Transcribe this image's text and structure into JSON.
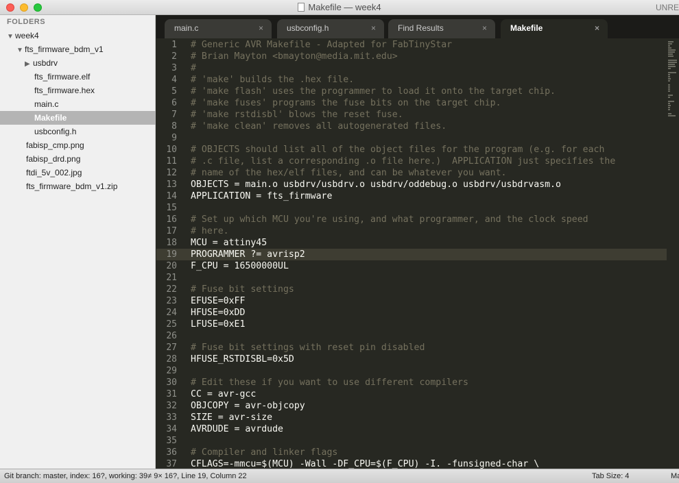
{
  "window": {
    "title": "Makefile — week4",
    "unregistered": "UNRE"
  },
  "sidebar": {
    "header": "FOLDERS",
    "items": [
      {
        "label": "week4",
        "arrow": "▼"
      },
      {
        "label": "fts_firmware_bdm_v1",
        "arrow": "▼"
      },
      {
        "label": "usbdrv",
        "arrow": "▶"
      },
      {
        "label": "fts_firmware.elf"
      },
      {
        "label": "fts_firmware.hex"
      },
      {
        "label": "main.c"
      },
      {
        "label": "Makefile"
      },
      {
        "label": "usbconfig.h"
      },
      {
        "label": "fabisp_cmp.png"
      },
      {
        "label": "fabisp_drd.png"
      },
      {
        "label": "ftdi_5v_002.jpg"
      },
      {
        "label": "fts_firmware_bdm_v1.zip"
      }
    ]
  },
  "tabs": [
    {
      "label": "main.c",
      "close": "×"
    },
    {
      "label": "usbconfig.h",
      "close": "×"
    },
    {
      "label": "Find Results",
      "close": "×"
    },
    {
      "label": "Makefile",
      "close": "×"
    }
  ],
  "editor": {
    "lines": [
      {
        "n": "1",
        "text": "# Generic AVR Makefile - Adapted for FabTinyStar"
      },
      {
        "n": "2",
        "text": "# Brian Mayton <bmayton@media.mit.edu>"
      },
      {
        "n": "3",
        "text": "#"
      },
      {
        "n": "4",
        "text": "# 'make' builds the .hex file."
      },
      {
        "n": "5",
        "text": "# 'make flash' uses the programmer to load it onto the target chip."
      },
      {
        "n": "6",
        "text": "# 'make fuses' programs the fuse bits on the target chip."
      },
      {
        "n": "7",
        "text": "# 'make rstdisbl' blows the reset fuse."
      },
      {
        "n": "8",
        "text": "# 'make clean' removes all autogenerated files."
      },
      {
        "n": "9",
        "text": ""
      },
      {
        "n": "10",
        "text": "# OBJECTS should list all of the object files for the program (e.g. for each"
      },
      {
        "n": "11",
        "text": "# .c file, list a corresponding .o file here.)  APPLICATION just specifies the"
      },
      {
        "n": "12",
        "text": "# name of the hex/elf files, and can be whatever you want."
      },
      {
        "n": "13",
        "text": "OBJECTS = main.o usbdrv/usbdrv.o usbdrv/oddebug.o usbdrv/usbdrvasm.o"
      },
      {
        "n": "14",
        "text": "APPLICATION = fts_firmware"
      },
      {
        "n": "15",
        "text": ""
      },
      {
        "n": "16",
        "text": "# Set up which MCU you're using, and what programmer, and the clock speed"
      },
      {
        "n": "17",
        "text": "# here."
      },
      {
        "n": "18",
        "text": "MCU = attiny45"
      },
      {
        "n": "19",
        "text": "PROGRAMMER ?= avrisp2"
      },
      {
        "n": "20",
        "text": "F_CPU = 16500000UL"
      },
      {
        "n": "21",
        "text": ""
      },
      {
        "n": "22",
        "text": "# Fuse bit settings"
      },
      {
        "n": "23",
        "text": "EFUSE=0xFF"
      },
      {
        "n": "24",
        "text": "HFUSE=0xDD"
      },
      {
        "n": "25",
        "text": "LFUSE=0xE1"
      },
      {
        "n": "26",
        "text": ""
      },
      {
        "n": "27",
        "text": "# Fuse bit settings with reset pin disabled"
      },
      {
        "n": "28",
        "text": "HFUSE_RSTDISBL=0x5D"
      },
      {
        "n": "29",
        "text": ""
      },
      {
        "n": "30",
        "text": "# Edit these if you want to use different compilers"
      },
      {
        "n": "31",
        "text": "CC = avr-gcc"
      },
      {
        "n": "32",
        "text": "OBJCOPY = avr-objcopy"
      },
      {
        "n": "33",
        "text": "SIZE = avr-size"
      },
      {
        "n": "34",
        "text": "AVRDUDE = avrdude"
      },
      {
        "n": "35",
        "text": ""
      },
      {
        "n": "36",
        "text": "# Compiler and linker flags"
      },
      {
        "n": "37",
        "text": "CFLAGS=-mmcu=$(MCU) -Wall -DF_CPU=$(F_CPU) -I. -funsigned-char \\"
      }
    ]
  },
  "statusbar": {
    "left": "Git branch: master, index: 16?, working: 39≠ 9× 16?, Line 19, Column 22",
    "tab_size": "Tab Size: 4",
    "syntax": "Ma"
  }
}
